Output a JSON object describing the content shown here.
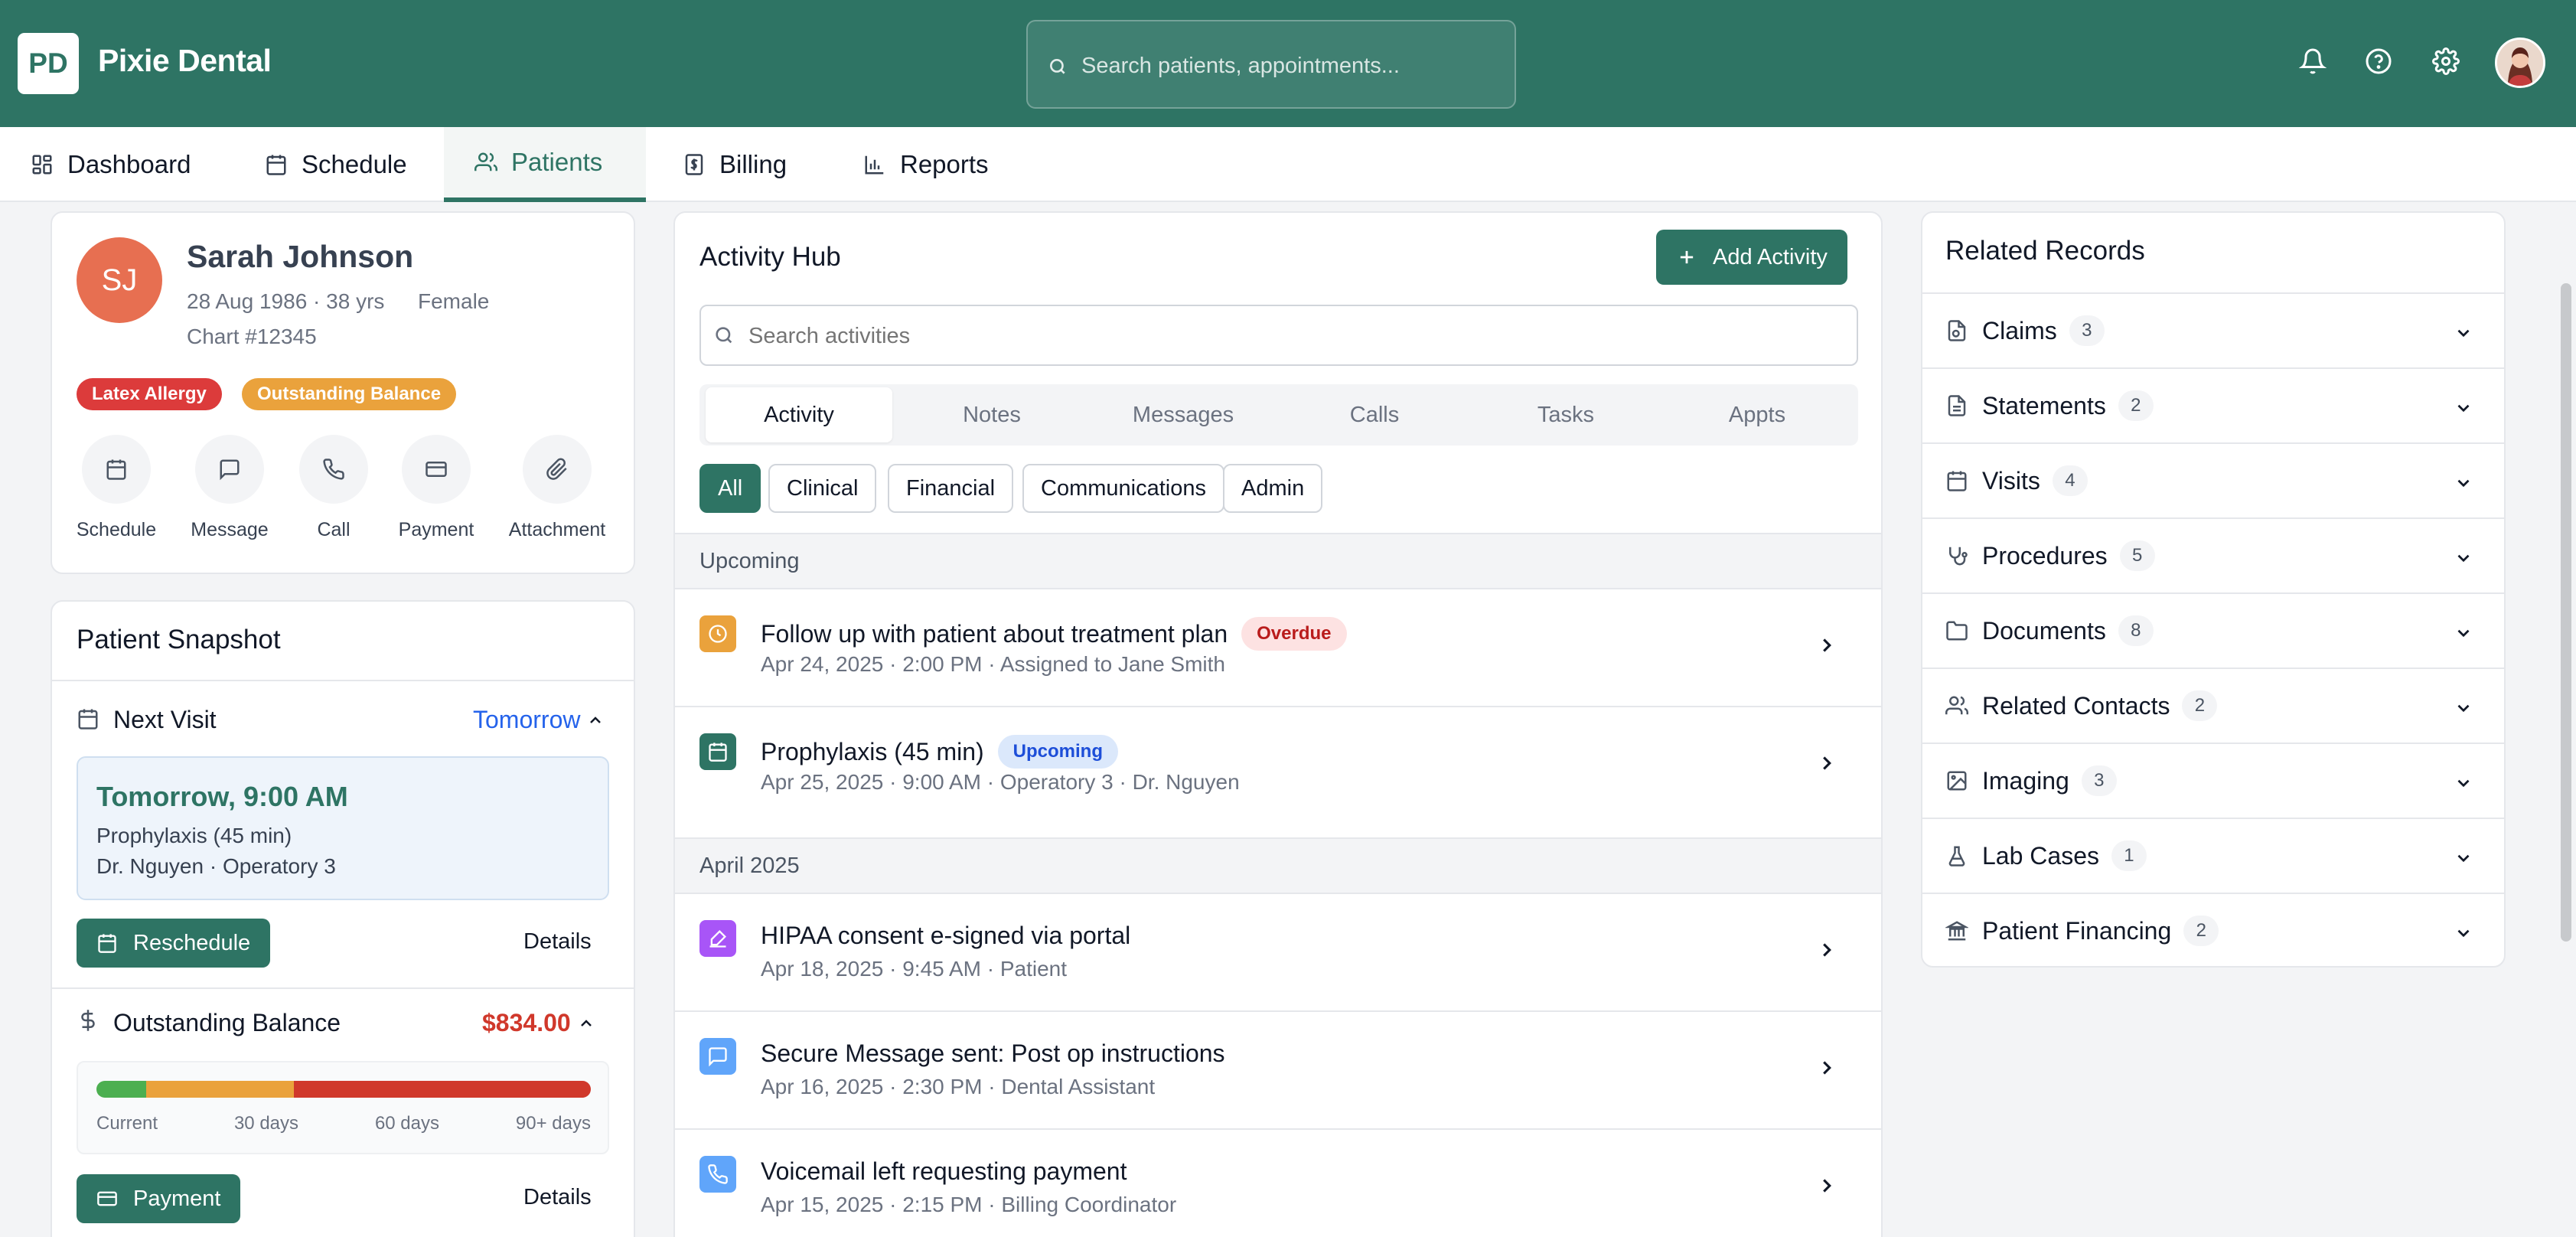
{
  "app": {
    "logo": "PD",
    "name": "Pixie Dental"
  },
  "header": {
    "search_placeholder": "Search patients, appointments...",
    "icons": [
      "bell-icon",
      "help-icon",
      "gear-icon"
    ]
  },
  "nav": {
    "tabs": [
      {
        "label": "Dashboard",
        "icon": "grid-icon"
      },
      {
        "label": "Schedule",
        "icon": "calendar-icon"
      },
      {
        "label": "Patients",
        "icon": "users-icon",
        "active": true
      },
      {
        "label": "Billing",
        "icon": "receipt-icon"
      },
      {
        "label": "Reports",
        "icon": "bar-chart-icon"
      }
    ]
  },
  "patient": {
    "initials": "SJ",
    "name": "Sarah Johnson",
    "meta": "28 Aug 1986 · 38 yrs",
    "sex": "Female",
    "chart": "Chart #12345",
    "tags": [
      "Latex Allergy",
      "Outstanding Balance"
    ],
    "actions": [
      "Schedule",
      "Message",
      "Call",
      "Payment",
      "Attachment"
    ]
  },
  "snapshot": {
    "title": "Patient Snapshot",
    "next_visit": {
      "label": "Next Visit",
      "when": "Tomorrow",
      "time": "Tomorrow, 9:00 AM",
      "procedure": "Prophylaxis (45 min)",
      "provider": "Dr. Nguyen · Operatory 3",
      "button": "Reschedule",
      "details": "Details"
    },
    "balance": {
      "label": "Outstanding Balance",
      "amount": "$834.00",
      "aging_labels": [
        "Current",
        "30 days",
        "60 days",
        "90+ days"
      ],
      "aging_shares": [
        0.1,
        0.3,
        0.6
      ],
      "aging_colors": [
        "#4caf50",
        "#eaa23c",
        "#d0382b"
      ],
      "button": "Payment",
      "details": "Details"
    }
  },
  "activity": {
    "title": "Activity Hub",
    "add_button": "Add Activity",
    "search_placeholder": "Search activities",
    "tabs": [
      "Activity",
      "Notes",
      "Messages",
      "Calls",
      "Tasks",
      "Appts"
    ],
    "active_tab": "Activity",
    "filters": [
      "All",
      "Clinical",
      "Financial",
      "Communications",
      "Admin"
    ],
    "active_filter": "All",
    "groups": [
      {
        "label": "Upcoming",
        "items": [
          {
            "title": "Follow up with patient about treatment plan",
            "badge": "Overdue",
            "sub": "Apr 24, 2025 · 2:00 PM · Assigned to Jane Smith",
            "icon": "clock-icon",
            "color": "#eaa23c"
          },
          {
            "title": "Prophylaxis (45 min)",
            "badge": "Upcoming",
            "sub": "Apr 25, 2025 · 9:00 AM · Operatory 3 · Dr. Nguyen",
            "icon": "calendar-icon",
            "color": "#2e7464"
          }
        ]
      },
      {
        "label": "April 2025",
        "items": [
          {
            "title": "HIPAA consent e-signed via portal",
            "sub": "Apr 18, 2025 · 9:45 AM · Patient",
            "icon": "signature-icon",
            "color": "#a855f7"
          },
          {
            "title": "Secure Message sent: Post op instructions",
            "sub": "Apr 16, 2025 · 2:30 PM · Dental Assistant",
            "icon": "message-icon",
            "color": "#60a5fa"
          },
          {
            "title": "Voicemail left requesting payment",
            "sub": "Apr 15, 2025 · 2:15 PM · Billing Coordinator",
            "icon": "phone-icon",
            "color": "#60a5fa"
          }
        ]
      }
    ]
  },
  "related": {
    "title": "Related Records",
    "items": [
      {
        "label": "Claims",
        "count": "3",
        "icon": "claims-icon"
      },
      {
        "label": "Statements",
        "count": "2",
        "icon": "document-icon"
      },
      {
        "label": "Visits",
        "count": "4",
        "icon": "calendar-icon"
      },
      {
        "label": "Procedures",
        "count": "5",
        "icon": "stethoscope-icon"
      },
      {
        "label": "Documents",
        "count": "8",
        "icon": "folder-icon"
      },
      {
        "label": "Related Contacts",
        "count": "2",
        "icon": "users-icon"
      },
      {
        "label": "Imaging",
        "count": "3",
        "icon": "image-icon"
      },
      {
        "label": "Lab Cases",
        "count": "1",
        "icon": "flask-icon"
      },
      {
        "label": "Patient Financing",
        "count": "2",
        "icon": "bank-icon"
      }
    ]
  }
}
